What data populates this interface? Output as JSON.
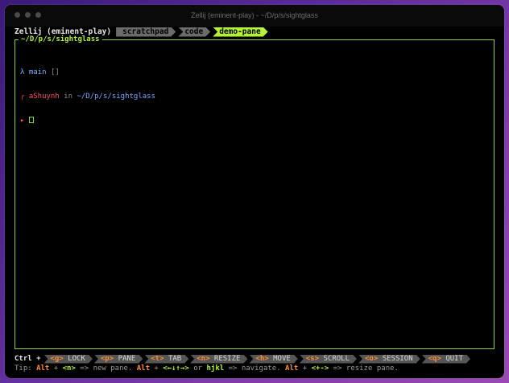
{
  "window": {
    "title": "Zellij (eminent-play) - ~/D/p/s/sightglass"
  },
  "tabbar": {
    "session": "Zellij (eminent-play)",
    "tabs": [
      {
        "label": "scratchpad",
        "active": false
      },
      {
        "label": "code",
        "active": false
      },
      {
        "label": "demo-pane",
        "active": true
      }
    ]
  },
  "pane": {
    "title": "~/D/p/s/sightglass",
    "lines": {
      "prompt_symbol": "λ",
      "branch": "main",
      "branch_status": "[]",
      "corner_top": "┌",
      "user": "aShuynh",
      "in_word": "in",
      "path": "~/D/p/s/sightglass",
      "corner_bottom": "▸"
    }
  },
  "statusbar": {
    "modifier": "Ctrl +",
    "keys": [
      {
        "key": "<g>",
        "label": "LOCK"
      },
      {
        "key": "<p>",
        "label": "PANE"
      },
      {
        "key": "<t>",
        "label": "TAB"
      },
      {
        "key": "<n>",
        "label": "RESIZE"
      },
      {
        "key": "<h>",
        "label": "MOVE"
      },
      {
        "key": "<s>",
        "label": "SCROLL"
      },
      {
        "key": "<o>",
        "label": "SESSION"
      },
      {
        "key": "<q>",
        "label": "QUIT"
      }
    ],
    "tip": {
      "prefix": "Tip: ",
      "alt1": "Alt",
      "plus1": " + ",
      "key1": "<n>",
      "text1": " => new pane. ",
      "alt2": "Alt",
      "plus2": " + ",
      "key2": "<←↓↑→>",
      "text2": " or ",
      "key3": "hjkl",
      "text3": " => navigate. ",
      "alt3": "Alt",
      "plus3": " + ",
      "key4": "<+->",
      "text4": " => resize pane."
    }
  },
  "colors": {
    "accent": "#b6f335",
    "key_highlight": "#ff8c3a",
    "user": "#ff4d6d",
    "path": "#7aa8ff"
  }
}
